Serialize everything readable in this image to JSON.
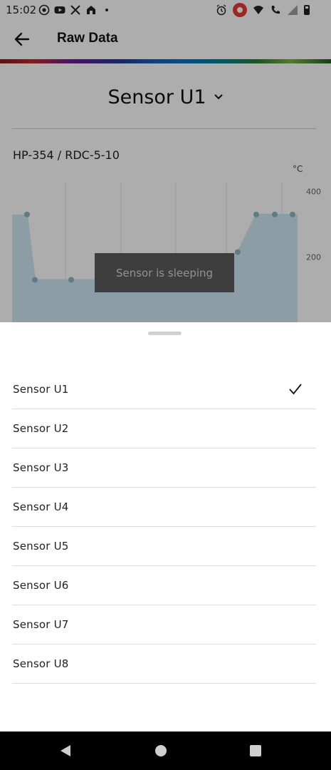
{
  "status_bar": {
    "time": "15:02",
    "left_icons": [
      "screen-record-icon",
      "youtube-icon",
      "x-icon",
      "home-app-icon",
      "dot-icon"
    ],
    "right_icons": [
      "alarm-icon",
      "recording-icon",
      "wifi-icon",
      "phone-icon",
      "signal-icon",
      "battery-icon"
    ]
  },
  "app_bar": {
    "back_icon": "arrow-left-icon",
    "title": "Raw Data"
  },
  "colors": {
    "scrim": "#000000",
    "toast_bg": "#5c5c5c",
    "chart_fill": "#cfe7f3",
    "chart_point": "#8fb4c8"
  },
  "sensor_selector": {
    "label": "Sensor U1",
    "icon": "chevron-down-icon"
  },
  "device": {
    "name": "HP-354 / RDC-5-10"
  },
  "chart": {
    "unit": "°C",
    "tick_labels": [
      "400",
      "200"
    ]
  },
  "chart_data": {
    "type": "area",
    "title": "",
    "xlabel": "",
    "ylabel": "°C",
    "y_ticks": [
      400,
      200
    ],
    "ylim": [
      0,
      430
    ],
    "grid": true,
    "series": [
      {
        "values": [
          330,
          130,
          130,
          130,
          130,
          130,
          215,
          330,
          330,
          330
        ]
      }
    ]
  },
  "toast": {
    "message": "Sensor is sleeping"
  },
  "sheet": {
    "handle": "drag-handle",
    "selected_index": 0,
    "check_icon": "checkmark-icon",
    "items": [
      {
        "label": "Sensor U1"
      },
      {
        "label": "Sensor U2"
      },
      {
        "label": "Sensor U3"
      },
      {
        "label": "Sensor U4"
      },
      {
        "label": "Sensor U5"
      },
      {
        "label": "Sensor U6"
      },
      {
        "label": "Sensor U7"
      },
      {
        "label": "Sensor U8"
      }
    ]
  },
  "nav_bar": {
    "buttons": [
      "back-triangle-icon",
      "home-circle-icon",
      "recents-square-icon"
    ]
  }
}
